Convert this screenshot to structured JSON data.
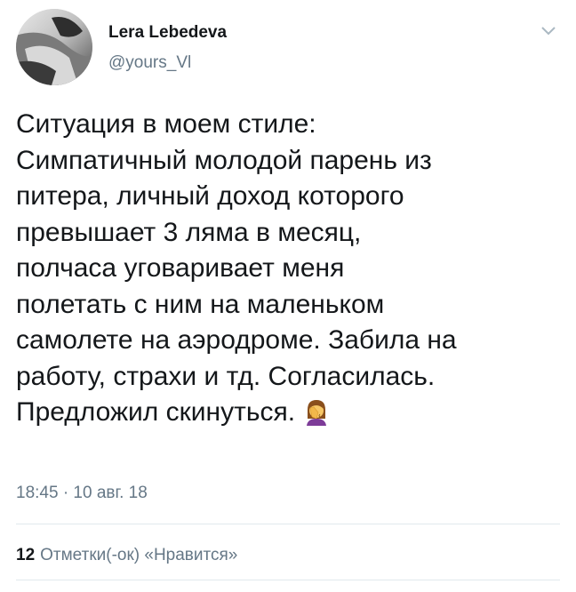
{
  "author": {
    "name": "Lera Lebedeva",
    "handle": "@yours_Vl"
  },
  "tweet": {
    "lines": [
      "Ситуация в моем стиле:",
      "Симпатичный молодой парень из",
      "питера, личный доход которого",
      "превышает 3 ляма в месяц,",
      "полчаса уговаривает меня",
      "полетать с ним на маленьком",
      "самолете на аэродроме. Забила на",
      "работу, страхи и тд. Согласилась.",
      "Предложил скинуться."
    ],
    "emoji": "woman-facepalming-icon",
    "timestamp": "18:45 · 10 авг. 18"
  },
  "stats": {
    "likes_count": "12",
    "likes_label": "Отметки(-ок) «Нравится»"
  }
}
